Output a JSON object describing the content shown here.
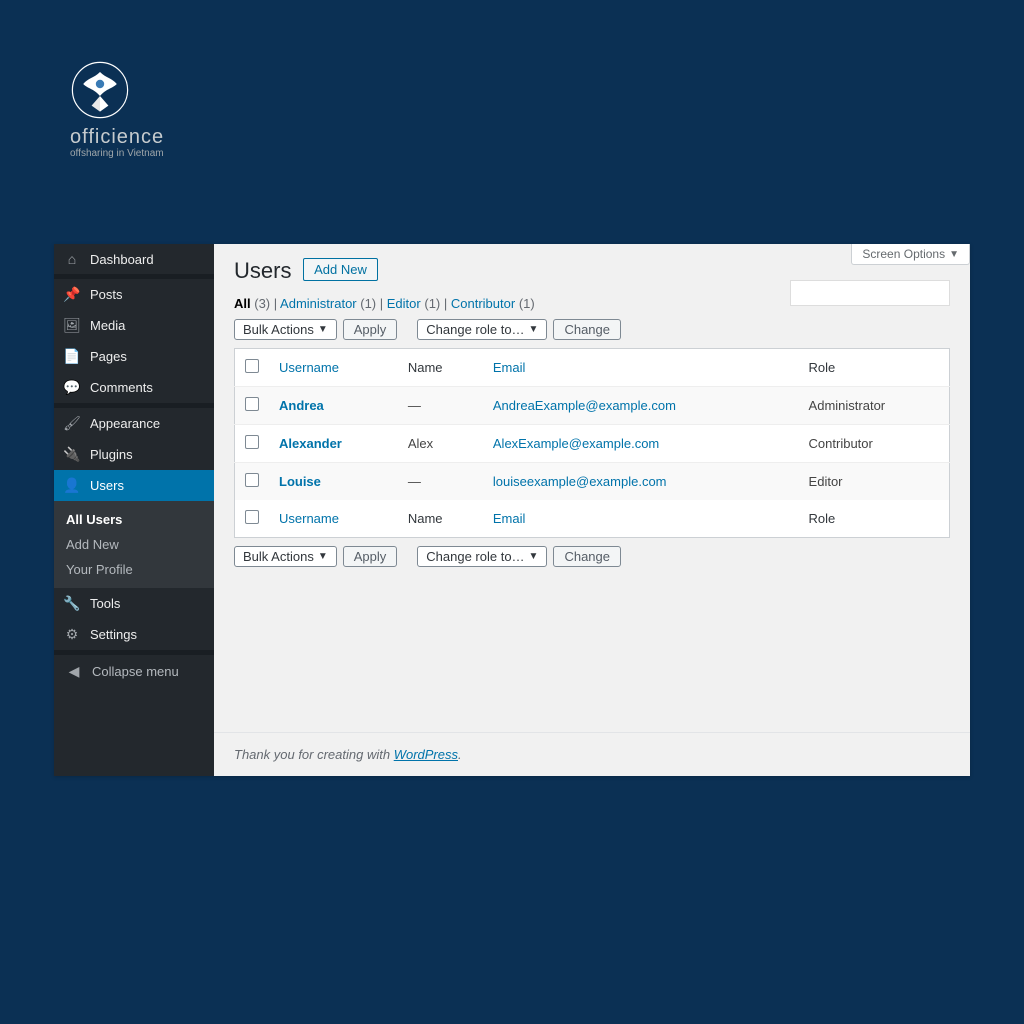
{
  "brand": {
    "name": "officience",
    "tagline": "offsharing in Vietnam"
  },
  "screen_options": "Screen Options",
  "sidebar": {
    "items": [
      {
        "icon": "dashboard-icon",
        "glyph": "⌂",
        "label": "Dashboard"
      },
      {
        "icon": "pin-icon",
        "glyph": "📌",
        "label": "Posts"
      },
      {
        "icon": "media-icon",
        "glyph": "🖼",
        "label": "Media"
      },
      {
        "icon": "pages-icon",
        "glyph": "📄",
        "label": "Pages"
      },
      {
        "icon": "comments-icon",
        "glyph": "💬",
        "label": "Comments"
      },
      {
        "icon": "appearance-icon",
        "glyph": "🖌",
        "label": "Appearance"
      },
      {
        "icon": "plugins-icon",
        "glyph": "🔌",
        "label": "Plugins"
      },
      {
        "icon": "users-icon",
        "glyph": "👤",
        "label": "Users",
        "current": true
      },
      {
        "icon": "tools-icon",
        "glyph": "🔧",
        "label": "Tools"
      },
      {
        "icon": "settings-icon",
        "glyph": "⚙",
        "label": "Settings"
      }
    ],
    "sub": [
      {
        "label": "All Users",
        "current": true
      },
      {
        "label": "Add New"
      },
      {
        "label": "Your Profile"
      }
    ],
    "collapse": "Collapse menu"
  },
  "header": {
    "title": "Users",
    "add_new": "Add New"
  },
  "views": {
    "all_label": "All",
    "all_count": "(3)",
    "admin_label": "Administrator",
    "admin_count": "(1)",
    "editor_label": "Editor",
    "editor_count": "(1)",
    "contrib_label": "Contributor",
    "contrib_count": "(1)",
    "sep": " | "
  },
  "actions": {
    "bulk_label": "Bulk Actions",
    "apply": "Apply",
    "role_label": "Change role to…",
    "change": "Change"
  },
  "columns": {
    "username": "Username",
    "name": "Name",
    "email": "Email",
    "role": "Role"
  },
  "rows": [
    {
      "username": "Andrea",
      "name": "—",
      "email": "AndreaExample@example.com",
      "role": "Administrator"
    },
    {
      "username": "Alexander",
      "name": "Alex",
      "email": "AlexExample@example.com",
      "role": "Contributor"
    },
    {
      "username": "Louise",
      "name": "—",
      "email": "louiseexample@example.com",
      "role": "Editor"
    }
  ],
  "footer": {
    "prefix": "Thank you for creating with ",
    "link": "WordPress",
    "suffix": "."
  }
}
